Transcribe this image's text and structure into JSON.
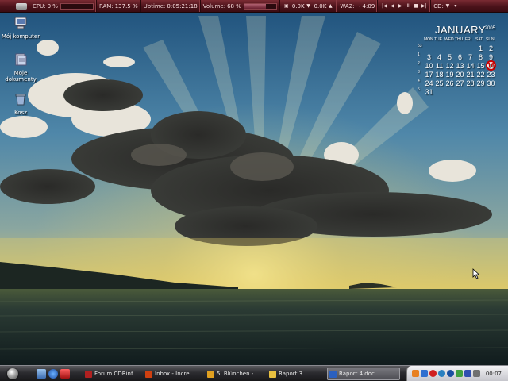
{
  "topbar": {
    "cpu_label": "CPU:",
    "cpu_value": "0 %",
    "cpu_fraction": 0.0,
    "ram_label": "RAM:",
    "ram_value": "137.5 %",
    "uptime_label": "Uptime:",
    "uptime_value": "0:05:21:18",
    "volume_label": "Volume:",
    "volume_value": "68 %",
    "volume_fraction": 0.68,
    "net_down": "0.0K",
    "net_up": "0.0K",
    "clock_label": "WA2:",
    "clock_value": "~ 4:09",
    "cd_label": "CD:",
    "colors": {
      "bar": "#4a121a",
      "text": "#f0d8d8"
    }
  },
  "desktop_icons": [
    {
      "label": "Mój komputer",
      "icon": "computer-icon"
    },
    {
      "label": "Moje dokumenty",
      "icon": "documents-icon"
    },
    {
      "label": "Kosz",
      "icon": "recycle-bin-icon"
    }
  ],
  "calendar": {
    "month": "JANUARY",
    "year": "2005",
    "weekdays": [
      "MON",
      "TUE",
      "WED",
      "THU",
      "FRI",
      "SAT",
      "SUN"
    ],
    "today": "16",
    "weeks": [
      {
        "num": "53",
        "days": [
          "",
          "",
          "",
          "",
          "",
          "1",
          "2"
        ]
      },
      {
        "num": "1",
        "days": [
          "3",
          "4",
          "5",
          "6",
          "7",
          "8",
          "9"
        ]
      },
      {
        "num": "2",
        "days": [
          "10",
          "11",
          "12",
          "13",
          "14",
          "15",
          "16"
        ]
      },
      {
        "num": "3",
        "days": [
          "17",
          "18",
          "19",
          "20",
          "21",
          "22",
          "23"
        ]
      },
      {
        "num": "4",
        "days": [
          "24",
          "25",
          "26",
          "27",
          "28",
          "29",
          "30"
        ]
      },
      {
        "num": "5",
        "days": [
          "31",
          "",
          "",
          "",
          "",
          "",
          ""
        ]
      }
    ],
    "today_color": "#cc0000"
  },
  "taskbar": {
    "tasks": [
      {
        "label": "Forum CDRinf...",
        "icon_color": "#b02020",
        "active": false
      },
      {
        "label": "Inbox - Incre...",
        "icon_color": "#d04010",
        "active": false
      },
      {
        "label": "5. Blünchen - ...",
        "icon_color": "#e0a020",
        "active": false
      },
      {
        "label": "Raport 3",
        "icon_color": "#e8c040",
        "active": false
      },
      {
        "label": "Raport 4.doc ...",
        "icon_color": "#2a60c0",
        "active": true
      }
    ],
    "quicklaunch": [
      "desktop-icon",
      "browser-icon",
      "media-icon"
    ],
    "tray_icons": [
      "network-icon",
      "shield-icon",
      "alert-icon",
      "update-icon",
      "info-icon",
      "messenger-icon",
      "language-icon",
      "volume-icon"
    ],
    "clock": "00:07"
  }
}
